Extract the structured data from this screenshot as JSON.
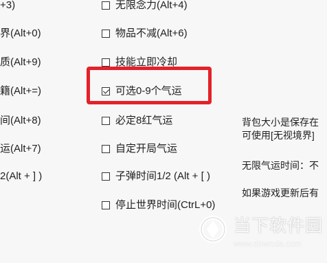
{
  "left_column": [
    "+3)",
    "界(Alt+0)",
    "质(Alt+9)",
    "籍(Alt+=)",
    "间(Alt+8)",
    "运(Alt+7)",
    "2(Alt + ] )"
  ],
  "middle_column": [
    {
      "label": "无限念力(Alt+4)",
      "checked": false
    },
    {
      "label": "物品不减(Alt+6)",
      "checked": false
    },
    {
      "label": "技能立即冷却",
      "checked": false
    },
    {
      "label": "可选0-9个气运",
      "checked": true
    },
    {
      "label": "必定8红气运",
      "checked": false
    },
    {
      "label": "自定开局气运",
      "checked": false
    },
    {
      "label": "子弹时间1/2 (Alt + [ )",
      "checked": false
    },
    {
      "label": "停止世界时间(CtrL+0)",
      "checked": false
    }
  ],
  "right_notes": [
    "背包大小是保存在",
    "可使用[无视境界]",
    "无限气运时间：不",
    "如果游戏更新后有"
  ],
  "watermark": {
    "title": "当下软件园",
    "url": "www.downxia.com"
  },
  "colors": {
    "background": "#f7f7f7",
    "highlight": "#e4212a",
    "text": "#1f1f1f"
  }
}
